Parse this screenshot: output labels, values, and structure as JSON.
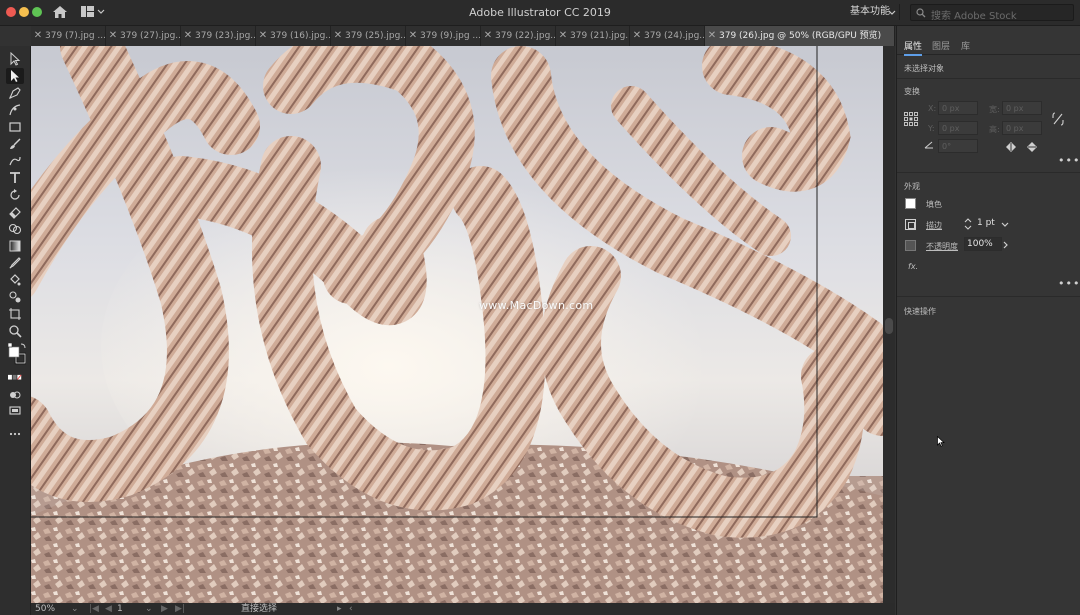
{
  "window": {
    "title": "Adobe Illustrator CC 2019",
    "workspace_label": "基本功能",
    "stock_placeholder": "搜索 Adobe Stock"
  },
  "tabs": [
    {
      "label": "379 (7).jpg ..."
    },
    {
      "label": "379 (27).jpg..."
    },
    {
      "label": "379 (23).jpg..."
    },
    {
      "label": "379 (16).jpg..."
    },
    {
      "label": "379 (25).jpg..."
    },
    {
      "label": "379 (9).jpg ..."
    },
    {
      "label": "379 (22).jpg..."
    },
    {
      "label": "379 (21).jpg..."
    },
    {
      "label": "379 (24).jpg..."
    },
    {
      "label": "379 (26).jpg @ 50% (RGB/GPU 预览)"
    }
  ],
  "canvas": {
    "watermark": "www.MacDown.com"
  },
  "status": {
    "zoom": "50%",
    "artboard": "1",
    "tool_name": "直接选择"
  },
  "panel": {
    "tabs": [
      "属性",
      "图层",
      "库"
    ],
    "no_selection": "未选择对象",
    "transform_title": "变换",
    "x_label": "X:",
    "x_value": "0 px",
    "y_label": "Y:",
    "y_value": "0 px",
    "w_label": "宽:",
    "w_value": "0 px",
    "h_label": "高:",
    "h_value": "0 px",
    "angle_value": "0°",
    "appearance_title": "外观",
    "fill_label": "填色",
    "stroke_label": "描边",
    "stroke_value": "1 pt",
    "opacity_label": "不透明度",
    "opacity_value": "100%",
    "fx_label": "fx.",
    "quick_actions_title": "快速操作",
    "more": "•••"
  },
  "colors": {
    "accent": "#5e9ee8",
    "fill_swatch": "#ffffff"
  }
}
